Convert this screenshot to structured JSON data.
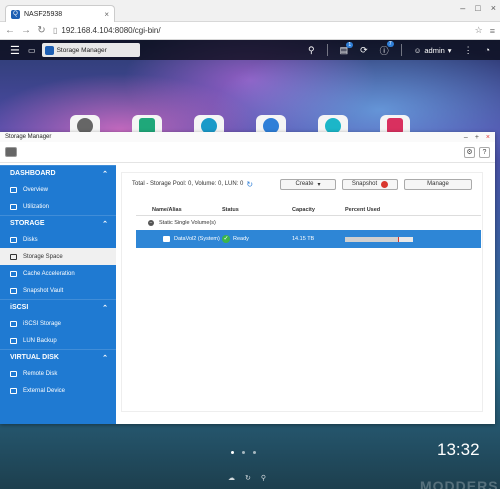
{
  "browser": {
    "tab_title": "NASF25938",
    "url": "192.168.4.104:8080/cgi-bin/"
  },
  "qts": {
    "active_app": "Storage Manager",
    "user": "admin",
    "badges": {
      "tasks": "1",
      "events": "7"
    }
  },
  "window": {
    "title": "Storage Manager"
  },
  "sidebar": {
    "sections": [
      {
        "title": "DASHBOARD",
        "items": [
          "Overview",
          "Utilization"
        ]
      },
      {
        "title": "STORAGE",
        "items": [
          "Disks",
          "Storage Space",
          "Cache Acceleration",
          "Snapshot Vault"
        ]
      },
      {
        "title": "iSCSI",
        "items": [
          "iSCSI Storage",
          "LUN Backup"
        ]
      },
      {
        "title": "VIRTUAL DISK",
        "items": [
          "Remote Disk",
          "External Device"
        ]
      }
    ],
    "active": "Storage Space"
  },
  "main": {
    "summary": "Total - Storage Pool: 0, Volume: 0, LUN: 0",
    "buttons": {
      "create": "Create",
      "snapshot": "Snapshot",
      "manage": "Manage"
    },
    "columns": [
      "Name/Alias",
      "Status",
      "Capacity",
      "Percent Used"
    ],
    "group": "Static Single Volume(s)",
    "volume": {
      "name": "DataVol2 (System)",
      "status": "Ready",
      "capacity": "14.15 TB",
      "percent_used": 0.78,
      "threshold": 0.78
    }
  },
  "desktop": {
    "clock": "13:32",
    "watermark": "MODDERS"
  },
  "colors": {
    "accent": "#1f7ad2",
    "selected_row": "#2e86d6",
    "ready": "#3bb54a",
    "snapshot_dot": "#d9372e"
  }
}
